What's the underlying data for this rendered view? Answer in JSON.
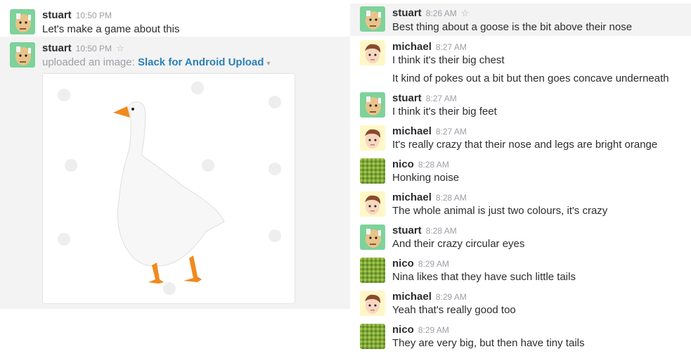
{
  "left": {
    "messages": [
      {
        "user": "stuart",
        "time": "10:50 PM",
        "text": "Let's make a game about this"
      },
      {
        "user": "stuart",
        "time": "10:50 PM",
        "star": "☆",
        "upload_prefix": "uploaded an image:",
        "file_title": "Slack for Android Upload",
        "caret": "▾",
        "image_alt": "white goose photo"
      }
    ]
  },
  "right": {
    "messages": [
      {
        "user": "stuart",
        "time": "8:26 AM",
        "star": "☆",
        "text": "Best thing about a goose is the bit above their nose"
      },
      {
        "user": "michael",
        "time": "8:27 AM",
        "text": "I think it's their big chest",
        "continuation": "It kind of pokes out a bit but then goes concave underneath"
      },
      {
        "user": "stuart",
        "time": "8:27 AM",
        "text": "I think it's their big feet"
      },
      {
        "user": "michael",
        "time": "8:27 AM",
        "text": "It's really crazy that their nose and legs are bright orange"
      },
      {
        "user": "nico",
        "time": "8:28 AM",
        "text": "Honking noise"
      },
      {
        "user": "michael",
        "time": "8:28 AM",
        "text": "The whole animal is just two colours, it's crazy"
      },
      {
        "user": "stuart",
        "time": "8:28 AM",
        "text": "And their crazy circular eyes"
      },
      {
        "user": "nico",
        "time": "8:29 AM",
        "text": "Nina likes that they have such little tails"
      },
      {
        "user": "michael",
        "time": "8:29 AM",
        "text": "Yeah that's really good too"
      },
      {
        "user": "nico",
        "time": "8:29 AM",
        "text": "They are very big, but then have tiny tails"
      }
    ]
  },
  "colors": {
    "link": "#2a80b9",
    "timestamp": "#9e9ea6",
    "highlight_row": "#f3f3f3",
    "stuart_avatar_bg": "#7ed29a",
    "michael_avatar_bg": "#fff7c7",
    "nico_avatar_bg": "#7fa83a",
    "goose_beak": "#f08a1e"
  },
  "icons": {
    "star": "star-outline-icon",
    "caret": "caret-down-icon",
    "stuart_avatar": "bald-man-avatar",
    "michael_avatar": "brown-hair-man-avatar",
    "nico_avatar": "green-checker-pattern-avatar"
  }
}
